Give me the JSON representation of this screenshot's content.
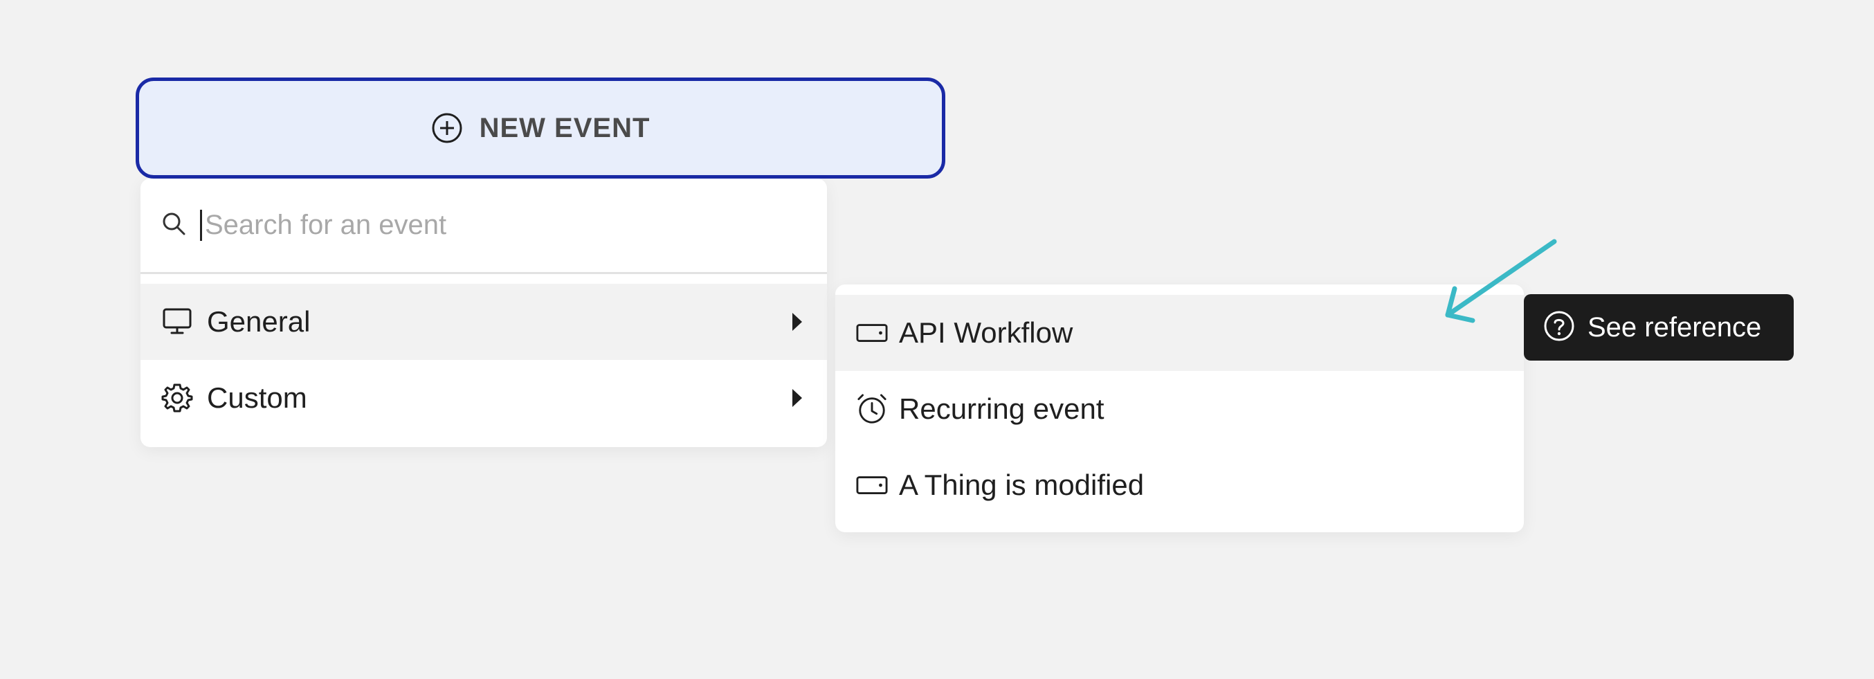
{
  "new_event_button": {
    "label": "NEW EVENT",
    "icon": "plus-circle-icon",
    "border_color": "#1a2aa6",
    "background": "#e8eefb"
  },
  "search": {
    "placeholder": "Search for an event",
    "value": "",
    "icon": "search-icon"
  },
  "menu": {
    "items": [
      {
        "label": "General",
        "icon": "monitor-icon",
        "has_submenu": true,
        "highlighted": true
      },
      {
        "label": "Custom",
        "icon": "gear-icon",
        "has_submenu": true,
        "highlighted": false
      }
    ]
  },
  "submenu": {
    "items": [
      {
        "label": "API Workflow",
        "icon": "server-icon",
        "highlighted": true
      },
      {
        "label": "Recurring event",
        "icon": "alarm-clock-icon",
        "highlighted": false
      },
      {
        "label": "A Thing is modified",
        "icon": "server-icon",
        "highlighted": false
      }
    ]
  },
  "tooltip": {
    "label": "See reference",
    "icon": "question-circle-icon",
    "background": "#1c1c1c"
  },
  "annotation": {
    "arrow_color": "#3bb9c6"
  }
}
